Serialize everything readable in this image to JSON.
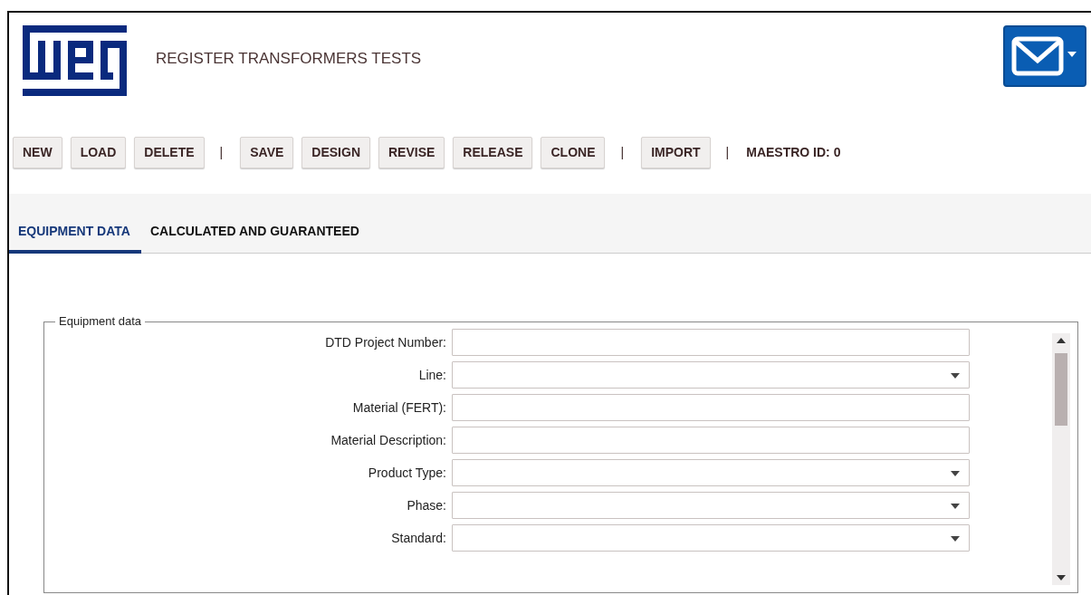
{
  "header": {
    "title": "REGISTER TRANSFORMERS TESTS"
  },
  "toolbar": [
    {
      "kind": "button",
      "label": "NEW"
    },
    {
      "kind": "button",
      "label": "LOAD"
    },
    {
      "kind": "button",
      "label": "DELETE"
    },
    {
      "kind": "separator",
      "label": "|"
    },
    {
      "kind": "button",
      "label": "SAVE"
    },
    {
      "kind": "button",
      "label": "DESIGN"
    },
    {
      "kind": "button",
      "label": "REVISE"
    },
    {
      "kind": "button",
      "label": "RELEASE"
    },
    {
      "kind": "button",
      "label": "CLONE"
    },
    {
      "kind": "separator",
      "label": "|"
    },
    {
      "kind": "button",
      "label": "IMPORT"
    },
    {
      "kind": "separator",
      "label": "|"
    },
    {
      "kind": "label",
      "label": "MAESTRO ID: 0"
    }
  ],
  "tabs": [
    {
      "label": "EQUIPMENT DATA",
      "selected": true
    },
    {
      "label": "CALCULATED AND GUARANTEED",
      "selected": false
    }
  ],
  "fieldset": {
    "legend": "Equipment data",
    "fields": [
      {
        "label": "DTD Project Number:",
        "kind": "text"
      },
      {
        "label": "Line:",
        "kind": "select"
      },
      {
        "label": "Material (FERT):",
        "kind": "text"
      },
      {
        "label": "Material Description:",
        "kind": "text"
      },
      {
        "label": "Product Type:",
        "kind": "select"
      },
      {
        "label": "Phase:",
        "kind": "select"
      },
      {
        "label": "Standard:",
        "kind": "select"
      }
    ]
  }
}
